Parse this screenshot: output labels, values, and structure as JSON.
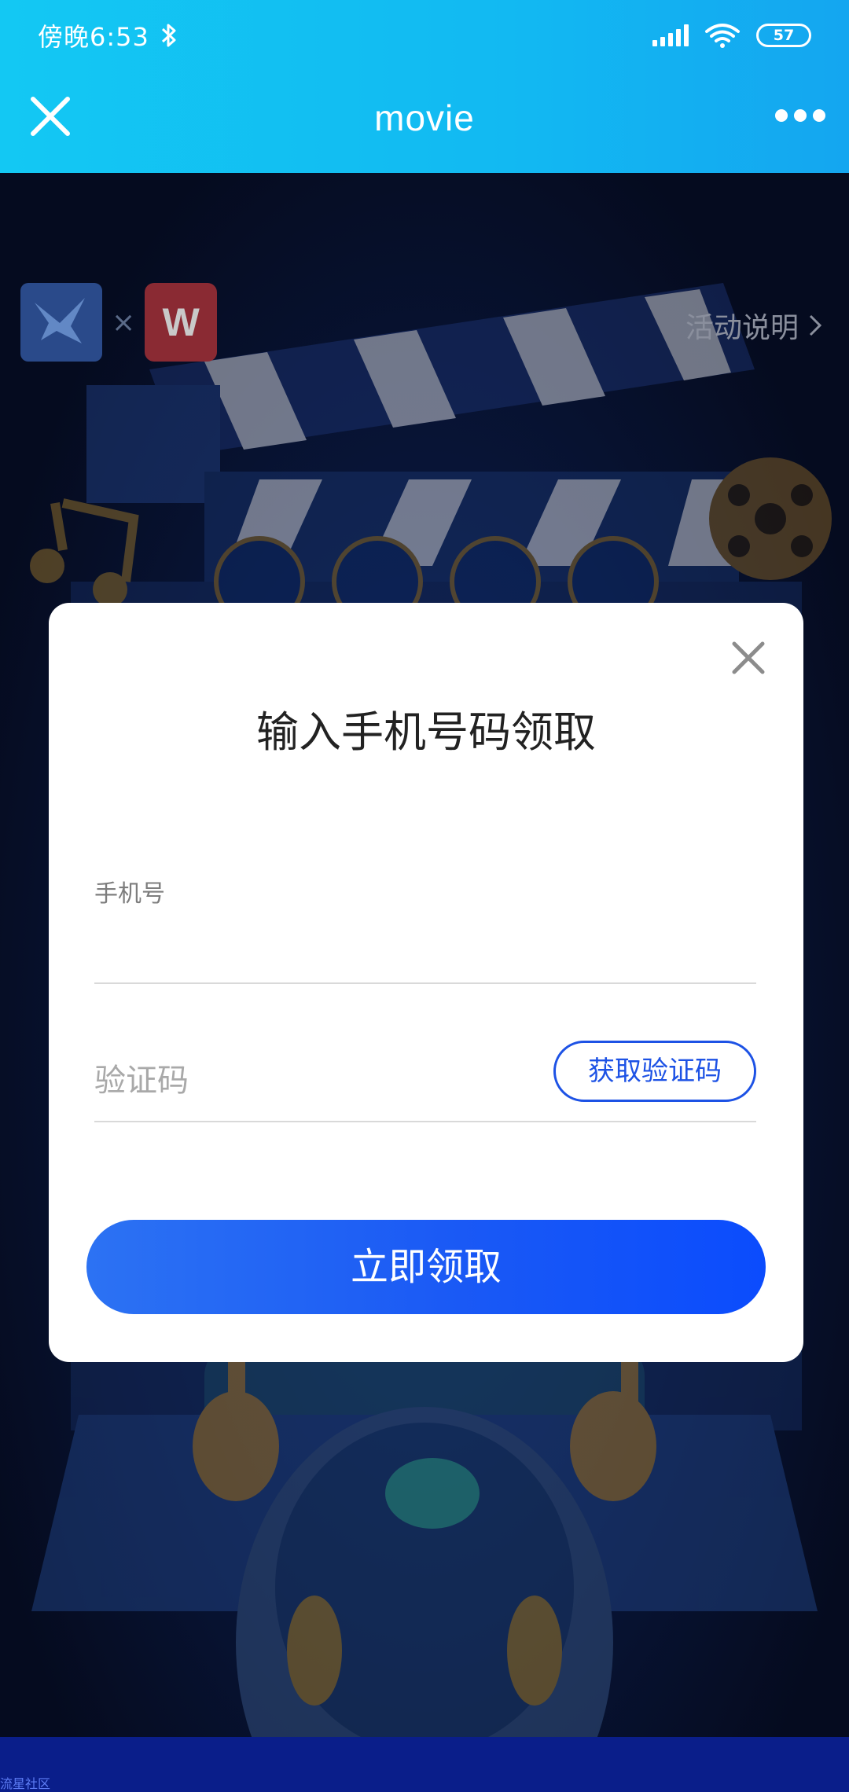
{
  "status_bar": {
    "time": "傍晚6:53",
    "battery": "57",
    "icons": [
      "bluetooth-icon",
      "signal-icon",
      "wifi-icon",
      "battery-icon"
    ]
  },
  "nav": {
    "title": "movie",
    "icons": [
      "close-icon",
      "more-icon"
    ]
  },
  "page": {
    "rules_link": "活动说明",
    "logo_separator": "×",
    "logo_wps_glyph": "W",
    "watermark": "流星社区"
  },
  "dialog": {
    "title": "输入手机号码领取",
    "phone_label": "手机号",
    "phone_value": "",
    "code_placeholder": "验证码",
    "get_code_label": "获取验证码",
    "submit_label": "立即领取"
  },
  "colors": {
    "header": "#13c8f3",
    "accent": "#1d52e5",
    "submit_end": "#0b4cfd"
  }
}
